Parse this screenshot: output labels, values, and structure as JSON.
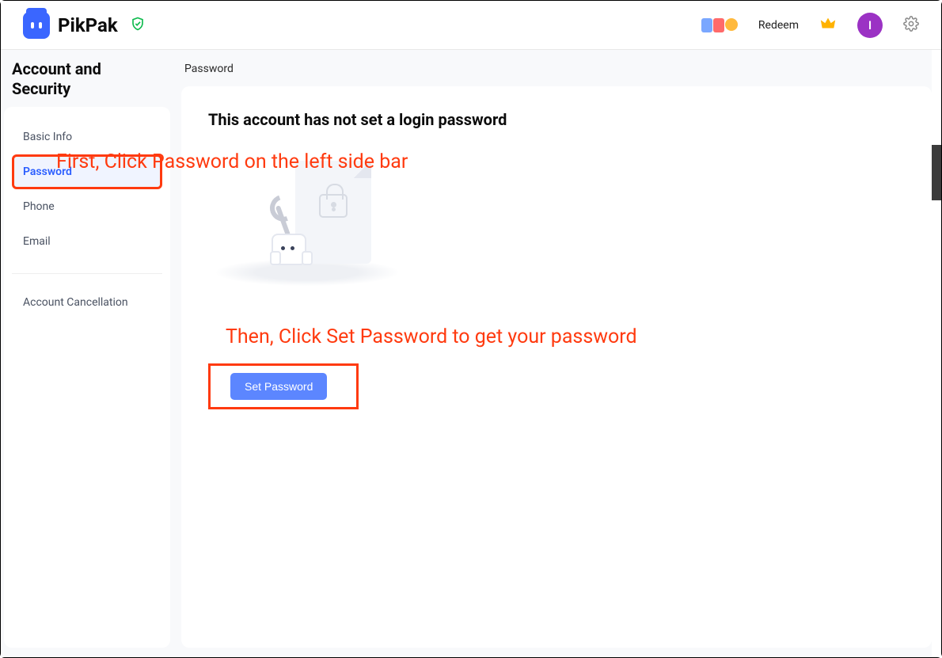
{
  "header": {
    "brand": "PikPak",
    "redeem_label": "Redeem",
    "avatar_initial": "I"
  },
  "sidebar": {
    "title": "Account and Security",
    "items": [
      {
        "label": "Basic Info"
      },
      {
        "label": "Password"
      },
      {
        "label": "Phone"
      },
      {
        "label": "Email"
      }
    ],
    "cancellation_label": "Account Cancellation"
  },
  "main": {
    "breadcrumb": "Password",
    "heading": "This account has not set a login password",
    "set_password_label": "Set Password"
  },
  "annotations": {
    "step1": "First, Click Password on the left side bar",
    "step2": "Then, Click Set Password to get your password"
  }
}
